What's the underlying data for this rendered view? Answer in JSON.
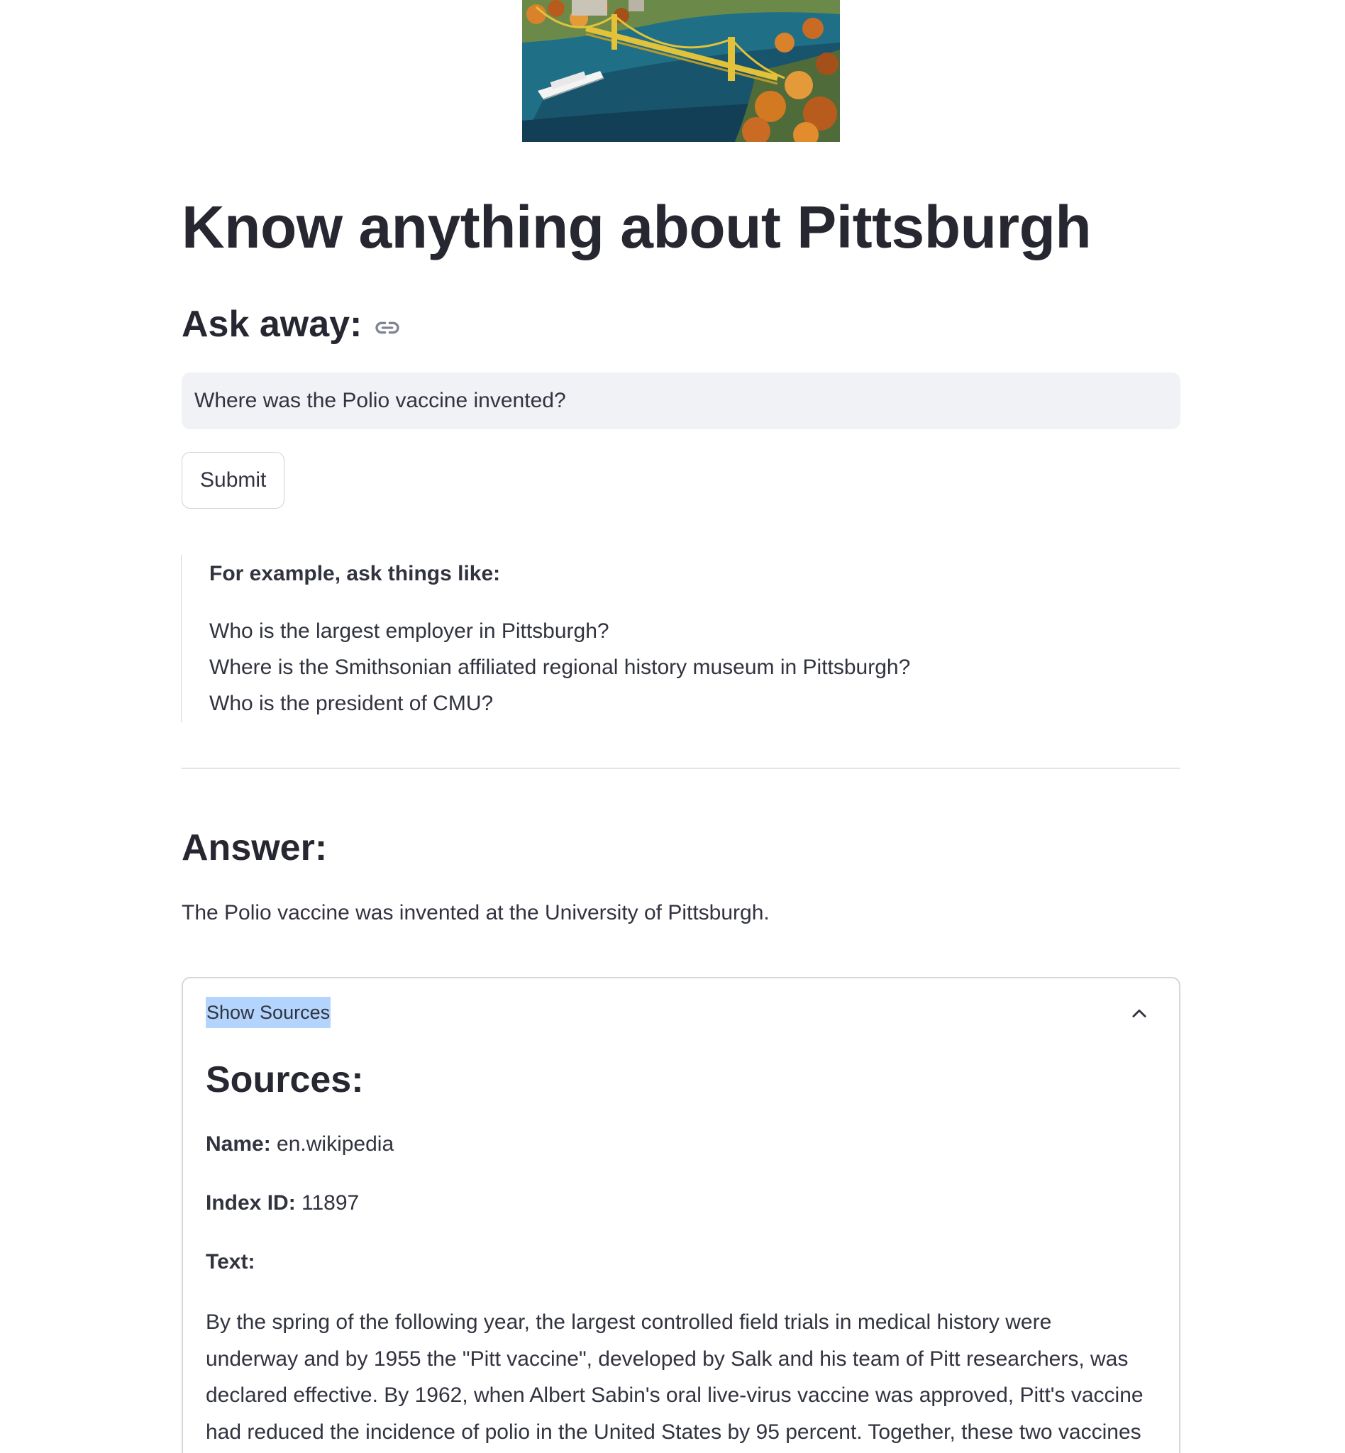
{
  "header": {
    "title": "Know anything about Pittsburgh",
    "hero_image": "pittsburgh-bridge-illustration"
  },
  "ask": {
    "heading": "Ask away:",
    "link_icon": "link-icon",
    "input_value": "Where was the Polio vaccine invented?",
    "submit_label": "Submit"
  },
  "examples": {
    "title": "For example, ask things like:",
    "items": [
      "Who is the largest employer in Pittsburgh?",
      "Where is the Smithsonian affiliated regional history museum in Pittsburgh?",
      "Who is the president of CMU?"
    ]
  },
  "answer": {
    "heading": "Answer:",
    "text": "The Polio vaccine was invented at the University of Pittsburgh."
  },
  "sources": {
    "toggle_label": "Show Sources",
    "toggle_icon": "chevron-up-icon",
    "heading": "Sources:",
    "name_label": "Name:",
    "name_value": "en.wikipedia",
    "index_label": "Index ID:",
    "index_value": "11897",
    "text_label": "Text:",
    "body": "By the spring of the following year, the largest controlled field trials in medical history were underway and by 1955 the \"Pitt vaccine\", developed by Salk and his team of Pitt researchers, was declared effective. By 1962, when Albert Sabin's oral live-virus vaccine was approved, Pitt's vaccine had reduced the incidence of polio in the United States by 95 percent. Together, these two vaccines"
  },
  "colors": {
    "input_bg": "#f0f2f6",
    "text": "#31333f",
    "selection": "#b3d4fc"
  }
}
